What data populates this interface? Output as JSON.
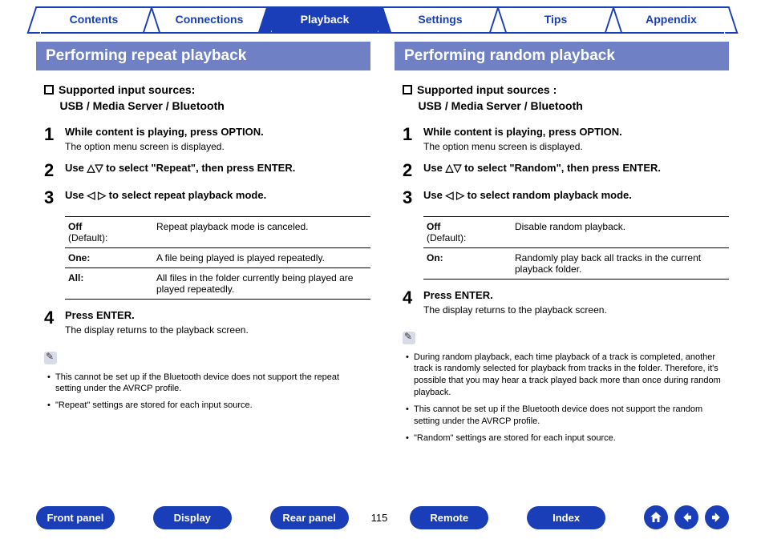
{
  "tabs": [
    "Contents",
    "Connections",
    "Playback",
    "Settings",
    "Tips",
    "Appendix"
  ],
  "active_tab_index": 2,
  "left": {
    "heading": "Performing repeat playback",
    "sub_heading_prefix": "Supported input sources:",
    "sub_heading_line2": "USB / Media Server / Bluetooth",
    "steps": [
      {
        "title": "While content is playing, press OPTION.",
        "desc": "The option menu screen is displayed."
      },
      {
        "title": "Use △▽ to select \"Repeat\", then press ENTER.",
        "desc": ""
      },
      {
        "title": "Use ◁ ▷ to select repeat playback mode.",
        "desc": ""
      },
      {
        "title": "Press ENTER.",
        "desc": "The display returns to the playback screen."
      }
    ],
    "options": [
      {
        "label": "Off",
        "label_suffix": "(Default):",
        "desc": "Repeat playback mode is canceled."
      },
      {
        "label": "One:",
        "label_suffix": "",
        "desc": "A file being played is played repeatedly."
      },
      {
        "label": "All:",
        "label_suffix": "",
        "desc": "All files in the folder currently being played are played repeatedly."
      }
    ],
    "notes": [
      "This cannot be set up if the Bluetooth device does not support the repeat setting under the AVRCP profile.",
      "\"Repeat\" settings are stored for each input source."
    ]
  },
  "right": {
    "heading": "Performing random playback",
    "sub_heading_prefix": "Supported input sources :",
    "sub_heading_line2": "USB / Media Server / Bluetooth",
    "steps": [
      {
        "title": "While content is playing, press OPTION.",
        "desc": "The option menu screen is displayed."
      },
      {
        "title": "Use △▽ to select \"Random\", then press ENTER.",
        "desc": ""
      },
      {
        "title": "Use ◁ ▷ to select random playback mode.",
        "desc": ""
      },
      {
        "title": "Press ENTER.",
        "desc": "The display returns to the playback screen."
      }
    ],
    "options": [
      {
        "label": "Off",
        "label_suffix": "(Default):",
        "desc": "Disable random playback."
      },
      {
        "label": "On:",
        "label_suffix": "",
        "desc": "Randomly play back all tracks in the current playback folder."
      }
    ],
    "notes": [
      "During random playback, each time playback of a track is completed, another track is randomly selected for playback from tracks in the folder. Therefore, it's possible that you may hear a track played back more than once during random playback.",
      "This cannot be set up if the Bluetooth device does not support the random setting under the AVRCP profile.",
      "\"Random\" settings are stored for each input source."
    ]
  },
  "footer": {
    "buttons": [
      "Front panel",
      "Display",
      "Rear panel",
      "Remote",
      "Index"
    ],
    "page": "115"
  }
}
